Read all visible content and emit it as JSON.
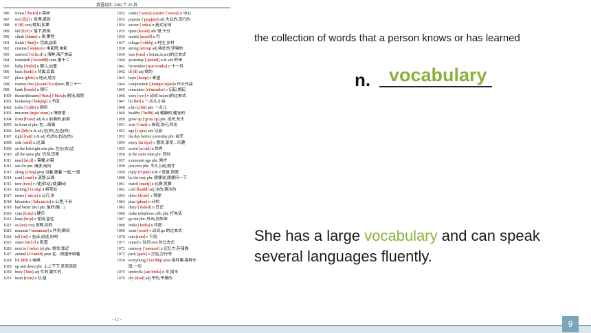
{
  "vocab_page": {
    "header": "英语词汇 2182 个 25 页",
    "page_number": "- 12 -",
    "left_column": [
      [
        "986",
        "forest ['forist] n 森林"
      ],
      [
        "987",
        "feel [fi:l] v 觉得,感到"
      ],
      [
        "988",
        "if [if] conj 假如,如果"
      ],
      [
        "989",
        "fall [fɔ:l] v 落下,跌倒"
      ],
      [
        "990",
        "climb [klaim] v 爬,攀登"
      ],
      [
        "991",
        "finish ['finiʃ] v 完成,结束"
      ],
      [
        "992",
        "cinema ['sinimə] n 电影院,电影"
      ],
      [
        "993",
        "seafood ['si:fu:d] n 海鲜,海产食品"
      ],
      [
        "994",
        "twentieth ['twentiiθ] num 第十二"
      ],
      [
        "995",
        "baby ['beibi] n 婴儿,幼童"
      ],
      [
        "996",
        "back [bæk] n 背面,后面"
      ],
      [
        "997",
        "place [pleis] n 地点,地方"
      ],
      [
        "998",
        "twenty-first [,twenti'fɜ:st]num 第二十一"
      ],
      [
        "999",
        "bank [bæŋk] n 银行"
      ],
      [
        "1000",
        "theater(theatre)['θiətə] ['θiətə]n 剧场,戏院"
      ],
      [
        "1001",
        "bookshop ['bukʃɒp] n 书店"
      ],
      [
        "1002",
        "toilet ['tɔilit] n 厕所"
      ],
      [
        "1003",
        "museum [mju:'ziəm] n 博物馆"
      ],
      [
        "1004",
        "front [frʌnt] adj & n 前面的,前部"
      ],
      [
        "1005",
        "in front of  phr. 在…前面"
      ],
      [
        "1006",
        "left [left] n & adj 左(的),左边(的)"
      ],
      [
        "1007",
        "right [rait] n & adj 右(的),右边(的)"
      ],
      [
        "1008",
        "side [said] n 边,面"
      ],
      [
        "1009",
        "on the left/right side  phr. 在左(右)边"
      ],
      [
        "1010",
        "all the same  phr. 仍然,还是"
      ],
      [
        "1011",
        "need [ni:d] v 需要,必需"
      ],
      [
        "1012",
        "ask for  phr. 请求,询问"
      ],
      [
        "1013",
        "along [ə'lɒŋ] prep 沿着,顺着 一起,一道"
      ],
      [
        "1014",
        "road [rəud] n 道路,公路"
      ],
      [
        "1015",
        "turn [tɜ:n] v (使)转动,(使)翻动"
      ],
      [
        "1016",
        "turning ['tɜ:niŋ] n 拐弯处"
      ],
      [
        "1017",
        "metre ['mi:tə] n 公尺,米"
      ],
      [
        "1018",
        "kilometre ['kilə,mi:tə] n 公里,千米"
      ],
      [
        "1019",
        "had better (do)  phr. 最好(做…)"
      ],
      [
        "1020",
        "coin [kɔin] n 硬币"
      ],
      [
        "1021",
        "keep [ki:p] v 保持,留住"
      ],
      [
        "1022",
        "as [æz] conj 按照,如同"
      ],
      [
        "1023",
        "moment ['məumənt] n 片刻,瞬间"
      ],
      [
        "1024",
        "tell [tel] v 告诉,讲述,吩咐"
      ],
      [
        "1025",
        "street [stri:t] n 街道"
      ],
      [
        "1026",
        "next to ['nekst tə] phr. 相邻,靠近"
      ],
      [
        "1027",
        "around [ə'raund] prep 在…周围环绕着"
      ],
      [
        "1028",
        "lift [lift] n 电梯"
      ],
      [
        "1029",
        "up and down  phr. 上上下下,来来回回"
      ],
      [
        "1030",
        "busy ['bizi] adj 忙的,繁忙的"
      ],
      [
        "1031",
        "team [ti:m] n 队,组"
      ]
    ],
    "right_column": [
      [
        "1032",
        "centre ['sentə] (center ['sentə]) n 中心"
      ],
      [
        "1033",
        "popular ['pɒpjulə] adj 大众的,流行的"
      ],
      [
        "1034",
        "soccer ['sɒkə] n 英式足球"
      ],
      [
        "1035",
        "quite [kwait] adv 很,十分"
      ],
      [
        "1036",
        "month [mʌnθ] n 月"
      ],
      [
        "1037",
        "village ['vilidʒ] n 村庄,乡村"
      ],
      [
        "1038",
        "strong [strɒŋ] adj 强壮的,坚强的"
      ],
      [
        "1039",
        "was [wɒz] v  be(am,is,are)的过去式"
      ],
      [
        "1040",
        "yesterday ['jestədi] n & adv 昨天"
      ],
      [
        "1041",
        "November [nəu'vembə] n 十一月"
      ],
      [
        "1042",
        "ill [il] adj 病的"
      ],
      [
        "1043",
        "hope [həup] v 希望"
      ],
      [
        "1044",
        "composition [,kɒmpə'ziʃən]n 作文作品"
      ],
      [
        "1045",
        "remember [ri'membə] v 记起,想起"
      ],
      [
        "1046",
        "were [wɜ:] v  动词 be(are)的过去式"
      ],
      [
        "1047",
        "bit [bit] n 一点儿,小片"
      ],
      [
        "1048",
        "a bit [ə'bit] phr. 一点儿"
      ],
      [
        "1049",
        "healthy ['helθi] adj 健康的,健壮的"
      ],
      [
        "1050",
        "grow up ['grəu ʌp] phr. 成长,长大"
      ],
      [
        "1051",
        "visit ['vizit] v 参观,访问,拜访"
      ],
      [
        "1052",
        "ago [ə'gəu] adv 以前"
      ],
      [
        "1053",
        "the day before yesterday  phr. 前天"
      ],
      [
        "1054",
        "enjoy [in'dʒɔi] v 喜欢,享受…乐趣"
      ],
      [
        "1055",
        "world [wɜ:ld] n 世界"
      ],
      [
        "1056",
        "at the same time  phr. 同时"
      ],
      [
        "1057",
        "a moment ago  phr. 刚才"
      ],
      [
        "1058",
        "just now  phr. 不久以前,刚才"
      ],
      [
        "1059",
        "reply [ri'plai] n & v 答复,回答"
      ],
      [
        "1060",
        "by the way  phr. 顺便说,顺便问一下"
      ],
      [
        "1061",
        "match [mætʃ] n 比赛,竞赛"
      ],
      [
        "1062",
        "cold [kəuld] adj 冷的,寒冷的"
      ],
      [
        "1063",
        "drive [draiv] v 驾驶"
      ],
      [
        "1064",
        "plan [plæn] n 计划"
      ],
      [
        "1065",
        "diary ['daiəri] n 日记"
      ],
      [
        "1066",
        "make telephone calls  phr. 打电话"
      ],
      [
        "1067",
        "go out  phr. 外出,到外面"
      ],
      [
        "1068",
        "India ['indiə] n 印度"
      ],
      [
        "1069",
        "went [went] v  动词 go 的过去式"
      ],
      [
        "1070",
        "rain [rein] v 下雨"
      ],
      [
        "1071",
        "rained  v  动词 rain 的过去式"
      ],
      [
        "1072",
        "memory ['meməri] n 记忆力,存储器"
      ],
      [
        "1073",
        "pack [pæk] v 打包,打行李"
      ],
      [
        "1074",
        "everything ['evriθiŋ] pron 每件事,每样东"
      ],
      [
        "",
        "西,一切"
      ],
      [
        "1075",
        "umbrella [ʌm'brelə] n 伞,雨伞"
      ],
      [
        "1076",
        "dry [drai] adj 干的,干燥的"
      ]
    ]
  },
  "definition": "the collection of words that a person knows or has learned",
  "answer": {
    "prefix": "n.",
    "word": "vocabulary"
  },
  "example": {
    "before": "She has a large ",
    "highlight": "vocabulary",
    "after": " and can speak several languages fluently."
  },
  "slide_number": "9",
  "colors": {
    "highlight": "#8db03a",
    "ipa": "#c0392b",
    "badge": "#7aa6bb",
    "footer_band": "#d9e6ee"
  }
}
